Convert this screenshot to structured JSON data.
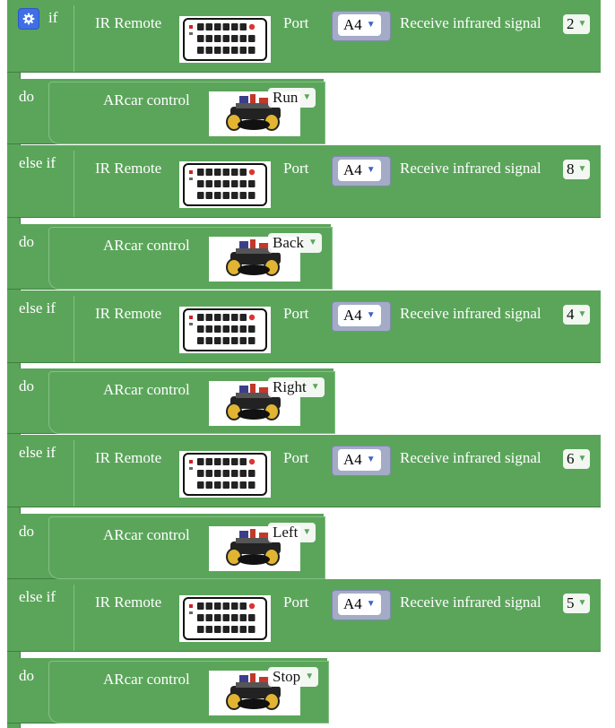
{
  "keywords": {
    "if": "if",
    "else_if": "else if",
    "do": "do"
  },
  "condition_block": {
    "ir_label": "IR Remote",
    "port_label": "Port",
    "receive_label": "Receive infrared signal"
  },
  "action_block": {
    "label": "ARcar control"
  },
  "colors": {
    "block_green": "#5ba55b",
    "gear_blue": "#3f6fe6",
    "port_slot": "#a3abc7"
  },
  "icons": {
    "gear": "gear-icon",
    "dropdown": "dropdown-triangle-icon",
    "ir_remote_image": "ir-remote-image",
    "car_image": "arcar-image"
  },
  "rows": [
    {
      "keyword": "if",
      "port": "A4",
      "signal": "2",
      "do_keyword": "do",
      "action": "Run"
    },
    {
      "keyword": "else if",
      "port": "A4",
      "signal": "8",
      "do_keyword": "do",
      "action": "Back"
    },
    {
      "keyword": "else if",
      "port": "A4",
      "signal": "4",
      "do_keyword": "do",
      "action": "Right"
    },
    {
      "keyword": "else if",
      "port": "A4",
      "signal": "6",
      "do_keyword": "do",
      "action": "Left"
    },
    {
      "keyword": "else if",
      "port": "A4",
      "signal": "5",
      "do_keyword": "do",
      "action": "Stop"
    }
  ]
}
